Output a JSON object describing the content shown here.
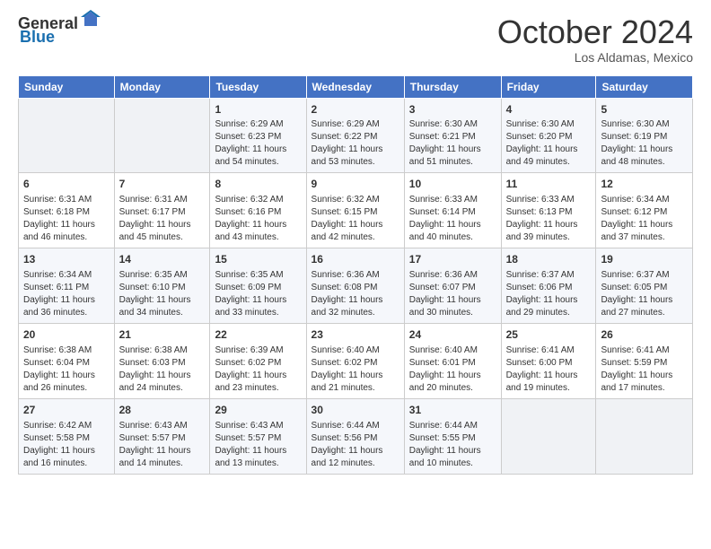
{
  "header": {
    "logo_general": "General",
    "logo_blue": "Blue",
    "month_title": "October 2024",
    "location": "Los Aldamas, Mexico"
  },
  "weekdays": [
    "Sunday",
    "Monday",
    "Tuesday",
    "Wednesday",
    "Thursday",
    "Friday",
    "Saturday"
  ],
  "weeks": [
    [
      {
        "day": "",
        "empty": true
      },
      {
        "day": "",
        "empty": true
      },
      {
        "day": "1",
        "sunrise": "Sunrise: 6:29 AM",
        "sunset": "Sunset: 6:23 PM",
        "daylight": "Daylight: 11 hours and 54 minutes."
      },
      {
        "day": "2",
        "sunrise": "Sunrise: 6:29 AM",
        "sunset": "Sunset: 6:22 PM",
        "daylight": "Daylight: 11 hours and 53 minutes."
      },
      {
        "day": "3",
        "sunrise": "Sunrise: 6:30 AM",
        "sunset": "Sunset: 6:21 PM",
        "daylight": "Daylight: 11 hours and 51 minutes."
      },
      {
        "day": "4",
        "sunrise": "Sunrise: 6:30 AM",
        "sunset": "Sunset: 6:20 PM",
        "daylight": "Daylight: 11 hours and 49 minutes."
      },
      {
        "day": "5",
        "sunrise": "Sunrise: 6:30 AM",
        "sunset": "Sunset: 6:19 PM",
        "daylight": "Daylight: 11 hours and 48 minutes."
      }
    ],
    [
      {
        "day": "6",
        "sunrise": "Sunrise: 6:31 AM",
        "sunset": "Sunset: 6:18 PM",
        "daylight": "Daylight: 11 hours and 46 minutes."
      },
      {
        "day": "7",
        "sunrise": "Sunrise: 6:31 AM",
        "sunset": "Sunset: 6:17 PM",
        "daylight": "Daylight: 11 hours and 45 minutes."
      },
      {
        "day": "8",
        "sunrise": "Sunrise: 6:32 AM",
        "sunset": "Sunset: 6:16 PM",
        "daylight": "Daylight: 11 hours and 43 minutes."
      },
      {
        "day": "9",
        "sunrise": "Sunrise: 6:32 AM",
        "sunset": "Sunset: 6:15 PM",
        "daylight": "Daylight: 11 hours and 42 minutes."
      },
      {
        "day": "10",
        "sunrise": "Sunrise: 6:33 AM",
        "sunset": "Sunset: 6:14 PM",
        "daylight": "Daylight: 11 hours and 40 minutes."
      },
      {
        "day": "11",
        "sunrise": "Sunrise: 6:33 AM",
        "sunset": "Sunset: 6:13 PM",
        "daylight": "Daylight: 11 hours and 39 minutes."
      },
      {
        "day": "12",
        "sunrise": "Sunrise: 6:34 AM",
        "sunset": "Sunset: 6:12 PM",
        "daylight": "Daylight: 11 hours and 37 minutes."
      }
    ],
    [
      {
        "day": "13",
        "sunrise": "Sunrise: 6:34 AM",
        "sunset": "Sunset: 6:11 PM",
        "daylight": "Daylight: 11 hours and 36 minutes."
      },
      {
        "day": "14",
        "sunrise": "Sunrise: 6:35 AM",
        "sunset": "Sunset: 6:10 PM",
        "daylight": "Daylight: 11 hours and 34 minutes."
      },
      {
        "day": "15",
        "sunrise": "Sunrise: 6:35 AM",
        "sunset": "Sunset: 6:09 PM",
        "daylight": "Daylight: 11 hours and 33 minutes."
      },
      {
        "day": "16",
        "sunrise": "Sunrise: 6:36 AM",
        "sunset": "Sunset: 6:08 PM",
        "daylight": "Daylight: 11 hours and 32 minutes."
      },
      {
        "day": "17",
        "sunrise": "Sunrise: 6:36 AM",
        "sunset": "Sunset: 6:07 PM",
        "daylight": "Daylight: 11 hours and 30 minutes."
      },
      {
        "day": "18",
        "sunrise": "Sunrise: 6:37 AM",
        "sunset": "Sunset: 6:06 PM",
        "daylight": "Daylight: 11 hours and 29 minutes."
      },
      {
        "day": "19",
        "sunrise": "Sunrise: 6:37 AM",
        "sunset": "Sunset: 6:05 PM",
        "daylight": "Daylight: 11 hours and 27 minutes."
      }
    ],
    [
      {
        "day": "20",
        "sunrise": "Sunrise: 6:38 AM",
        "sunset": "Sunset: 6:04 PM",
        "daylight": "Daylight: 11 hours and 26 minutes."
      },
      {
        "day": "21",
        "sunrise": "Sunrise: 6:38 AM",
        "sunset": "Sunset: 6:03 PM",
        "daylight": "Daylight: 11 hours and 24 minutes."
      },
      {
        "day": "22",
        "sunrise": "Sunrise: 6:39 AM",
        "sunset": "Sunset: 6:02 PM",
        "daylight": "Daylight: 11 hours and 23 minutes."
      },
      {
        "day": "23",
        "sunrise": "Sunrise: 6:40 AM",
        "sunset": "Sunset: 6:02 PM",
        "daylight": "Daylight: 11 hours and 21 minutes."
      },
      {
        "day": "24",
        "sunrise": "Sunrise: 6:40 AM",
        "sunset": "Sunset: 6:01 PM",
        "daylight": "Daylight: 11 hours and 20 minutes."
      },
      {
        "day": "25",
        "sunrise": "Sunrise: 6:41 AM",
        "sunset": "Sunset: 6:00 PM",
        "daylight": "Daylight: 11 hours and 19 minutes."
      },
      {
        "day": "26",
        "sunrise": "Sunrise: 6:41 AM",
        "sunset": "Sunset: 5:59 PM",
        "daylight": "Daylight: 11 hours and 17 minutes."
      }
    ],
    [
      {
        "day": "27",
        "sunrise": "Sunrise: 6:42 AM",
        "sunset": "Sunset: 5:58 PM",
        "daylight": "Daylight: 11 hours and 16 minutes."
      },
      {
        "day": "28",
        "sunrise": "Sunrise: 6:43 AM",
        "sunset": "Sunset: 5:57 PM",
        "daylight": "Daylight: 11 hours and 14 minutes."
      },
      {
        "day": "29",
        "sunrise": "Sunrise: 6:43 AM",
        "sunset": "Sunset: 5:57 PM",
        "daylight": "Daylight: 11 hours and 13 minutes."
      },
      {
        "day": "30",
        "sunrise": "Sunrise: 6:44 AM",
        "sunset": "Sunset: 5:56 PM",
        "daylight": "Daylight: 11 hours and 12 minutes."
      },
      {
        "day": "31",
        "sunrise": "Sunrise: 6:44 AM",
        "sunset": "Sunset: 5:55 PM",
        "daylight": "Daylight: 11 hours and 10 minutes."
      },
      {
        "day": "",
        "empty": true
      },
      {
        "day": "",
        "empty": true
      }
    ]
  ]
}
